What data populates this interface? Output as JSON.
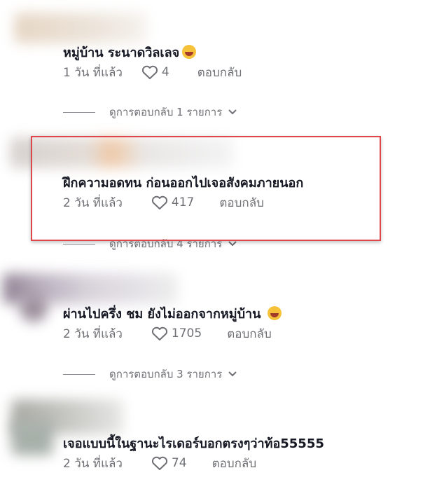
{
  "comments": [
    {
      "text": "หมู่บ้าน ระนาดวิลเลจ",
      "emoji": "laughing-crying-emoji",
      "time": "1 วัน ที่แล้ว",
      "likes": "4",
      "reply": "ตอบกลับ",
      "view_replies": "ดูการตอบกลับ 1 รายการ"
    },
    {
      "text": "ฝึกความอดทน ก่อนออกไปเจอสังคมภายนอก",
      "time": "2 วัน ที่แล้ว",
      "likes": "417",
      "reply": "ตอบกลับ",
      "view_replies": "ดูการตอบกลับ 4 รายการ"
    },
    {
      "text": "ผ่านไปครึ่ง ชม ยังไม่ออกจากหมู่บ้าน",
      "emoji": "laughing-crying-emoji",
      "time": "2 วัน ที่แล้ว",
      "likes": "1705",
      "reply": "ตอบกลับ",
      "view_replies": "ดูการตอบกลับ 3 รายการ"
    },
    {
      "text": "เจอแบบนี้ในฐานะไรเดอร์บอกตรงๆว่าท้อ55555",
      "time": "2 วัน ที่แล้ว",
      "likes": "74",
      "reply": "ตอบกลับ"
    }
  ],
  "colors": {
    "text": "#161823",
    "meta": "#6f7075",
    "highlight_border": "#e0474c"
  }
}
